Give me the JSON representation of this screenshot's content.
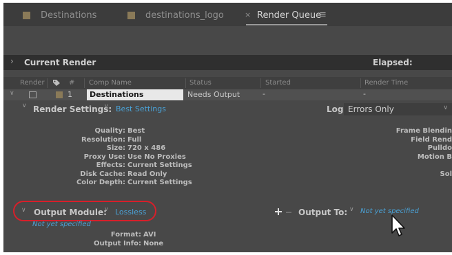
{
  "tabs": [
    {
      "label": "Destinations",
      "active": false
    },
    {
      "label": "destinations_logo",
      "active": false
    },
    {
      "label": "Render Queue",
      "active": true
    }
  ],
  "tab_close_glyph": "×",
  "tab_menu_glyph": "≡",
  "current_render": {
    "label": "Current Render",
    "elapsed_label": "Elapsed:"
  },
  "columns": {
    "render": "Render",
    "tag_icon": "tag-icon",
    "hash": "#",
    "comp_name": "Comp Name",
    "status": "Status",
    "started": "Started",
    "render_time": "Render Time"
  },
  "queue_item": {
    "number": "1",
    "comp_name": "Destinations",
    "status": "Needs Output",
    "started": "-",
    "render_time": "-",
    "label_color": "#8a7a58"
  },
  "render_settings": {
    "label": "Render Settings:",
    "value": "Best Settings",
    "log_label": "Log:",
    "log_value": "Errors Only"
  },
  "settings_details": [
    {
      "key": "Quality:",
      "value": "Best"
    },
    {
      "key": "Resolution:",
      "value": "Full"
    },
    {
      "key": "Size:",
      "value": "720 x 486"
    },
    {
      "key": "Proxy Use:",
      "value": "Use No Proxies"
    },
    {
      "key": "Effects:",
      "value": "Current Settings"
    },
    {
      "key": "Disk Cache:",
      "value": "Read Only"
    },
    {
      "key": "Color Depth:",
      "value": "Current Settings"
    }
  ],
  "settings_right": [
    "Frame Blendin",
    "Field Rend",
    "Pulldo",
    "Motion B",
    "",
    "Sol"
  ],
  "output_module": {
    "label": "Output Module:",
    "value": "Lossless",
    "sub": "Not yet specified",
    "output_to_label": "Output To:",
    "output_to_value": "Not yet specified",
    "details": [
      {
        "key": "Format:",
        "value": "AVI"
      },
      {
        "key": "Output Info:",
        "value": "None"
      }
    ]
  },
  "colors": {
    "accent_link": "#4aa3d8",
    "highlight_ring": "#d81f2a",
    "panel": "#484848"
  }
}
